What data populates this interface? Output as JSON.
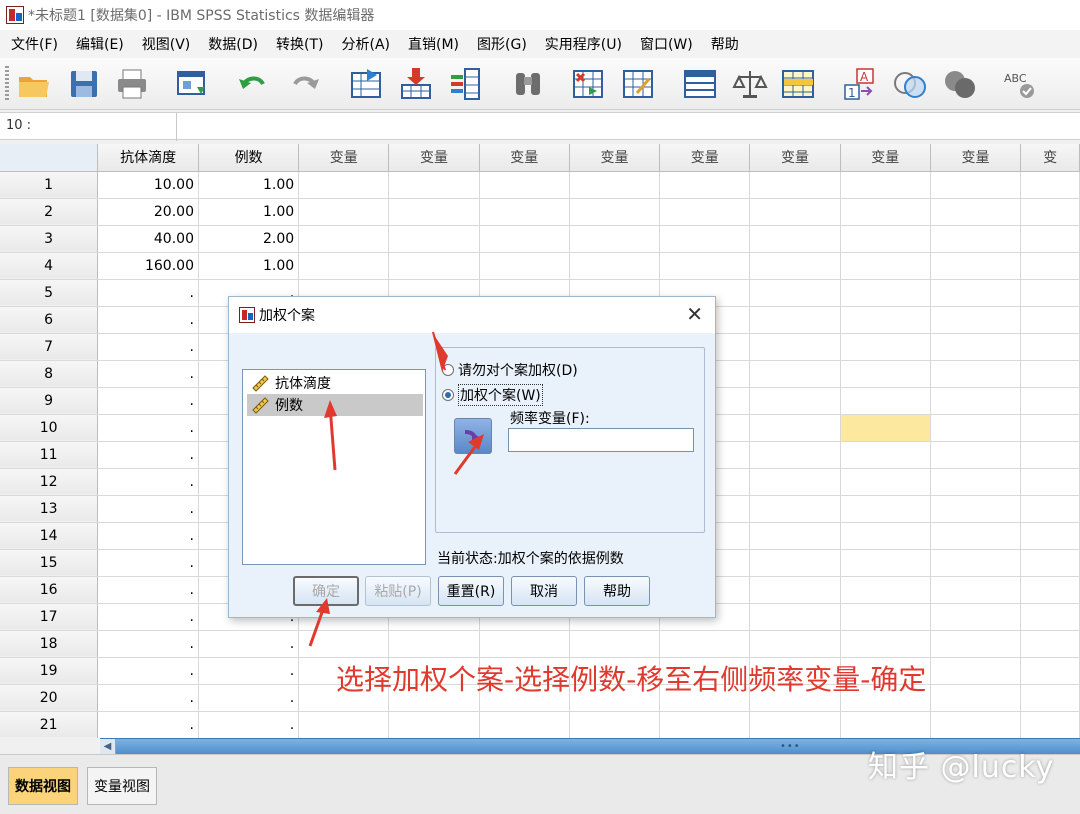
{
  "window": {
    "title": "*未标题1 [数据集0] - IBM SPSS Statistics 数据编辑器"
  },
  "menu": [
    "文件(F)",
    "编辑(E)",
    "视图(V)",
    "数据(D)",
    "转换(T)",
    "分析(A)",
    "直销(M)",
    "图形(G)",
    "实用程序(U)",
    "窗口(W)",
    "帮助"
  ],
  "toolbar": {
    "icons": [
      "open-folder-icon",
      "save-disk-icon",
      "print-icon",
      "dialog-recall-icon",
      "undo-icon",
      "redo-icon",
      "goto-case-icon",
      "goto-variable-icon",
      "variables-icon",
      "find-binoculars-icon",
      "insert-cases-icon",
      "insert-variable-icon",
      "split-file-icon",
      "weight-cases-icon",
      "select-cases-icon",
      "value-labels-icon",
      "use-sets-icon",
      "show-all-variables-icon",
      "spell-check-icon"
    ]
  },
  "cellbar": {
    "ref": "10 :"
  },
  "grid": {
    "columns": [
      "抗体滴度",
      "例数",
      "变量",
      "变量",
      "变量",
      "变量",
      "变量",
      "变量",
      "变量",
      "变量",
      "变"
    ],
    "rows": [
      {
        "n": "1",
        "c1": "10.00",
        "c2": "1.00"
      },
      {
        "n": "2",
        "c1": "20.00",
        "c2": "1.00"
      },
      {
        "n": "3",
        "c1": "40.00",
        "c2": "2.00"
      },
      {
        "n": "4",
        "c1": "160.00",
        "c2": "1.00"
      },
      {
        "n": "5",
        "c1": ".",
        "c2": "."
      },
      {
        "n": "6",
        "c1": ".",
        "c2": "."
      },
      {
        "n": "7",
        "c1": ".",
        "c2": "."
      },
      {
        "n": "8",
        "c1": ".",
        "c2": "."
      },
      {
        "n": "9",
        "c1": ".",
        "c2": "."
      },
      {
        "n": "10",
        "c1": ".",
        "c2": "."
      },
      {
        "n": "11",
        "c1": ".",
        "c2": "."
      },
      {
        "n": "12",
        "c1": ".",
        "c2": "."
      },
      {
        "n": "13",
        "c1": ".",
        "c2": "."
      },
      {
        "n": "14",
        "c1": ".",
        "c2": "."
      },
      {
        "n": "15",
        "c1": ".",
        "c2": "."
      },
      {
        "n": "16",
        "c1": ".",
        "c2": "."
      },
      {
        "n": "17",
        "c1": ".",
        "c2": "."
      },
      {
        "n": "18",
        "c1": ".",
        "c2": "."
      },
      {
        "n": "19",
        "c1": ".",
        "c2": "."
      },
      {
        "n": "20",
        "c1": ".",
        "c2": "."
      },
      {
        "n": "21",
        "c1": ".",
        "c2": "."
      }
    ]
  },
  "tabs": {
    "data_view": "数据视图",
    "variable_view": "变量视图"
  },
  "watermark": "知乎 @lucky",
  "dialog": {
    "title": "加权个案",
    "variables": [
      "抗体滴度",
      "例数"
    ],
    "radio_no_weight": "请勿对个案加权(D)",
    "radio_weight": "加权个案(W)",
    "freq_label": "频率变量(F):",
    "freq_value": "",
    "status": "当前状态:加权个案的依据例数",
    "buttons": {
      "ok": "确定",
      "paste": "粘贴(P)",
      "reset": "重置(R)",
      "cancel": "取消",
      "help": "帮助"
    }
  },
  "annotation": "选择加权个案-选择例数-移至右侧频率变量-确定",
  "colors": {
    "annotation": "#e03a2f",
    "highlight_cell": "#fde8a0",
    "active_tab": "#fbd37a",
    "dialog_bg": "#e9f1fa"
  }
}
